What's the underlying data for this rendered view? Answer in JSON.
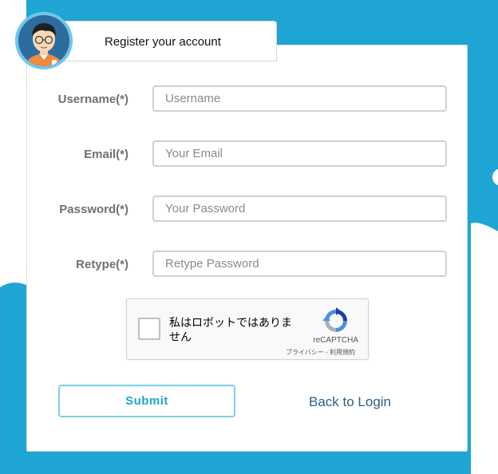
{
  "colors": {
    "background_blue": "#1fa5d4",
    "accent": "#21a5cf",
    "link": "#2a5f8a"
  },
  "header": {
    "title": "Register your account",
    "avatar_icon": "user-avatar-icon"
  },
  "form": {
    "fields": [
      {
        "label": "Username(*)",
        "placeholder": "Username",
        "value": ""
      },
      {
        "label": "Email(*)",
        "placeholder": "Your Email",
        "value": ""
      },
      {
        "label": "Password(*)",
        "placeholder": "Your Password",
        "value": ""
      },
      {
        "label": "Retype(*)",
        "placeholder": "Retype Password",
        "value": ""
      }
    ],
    "captcha": {
      "checkbox_text": "私はロボットではありません",
      "brand": "reCAPTCHA",
      "links": "プライバシー - 利用規約",
      "logo_icon": "recaptcha-logo-icon"
    },
    "submit_label": "Submit",
    "back_link": "Back to Login"
  }
}
